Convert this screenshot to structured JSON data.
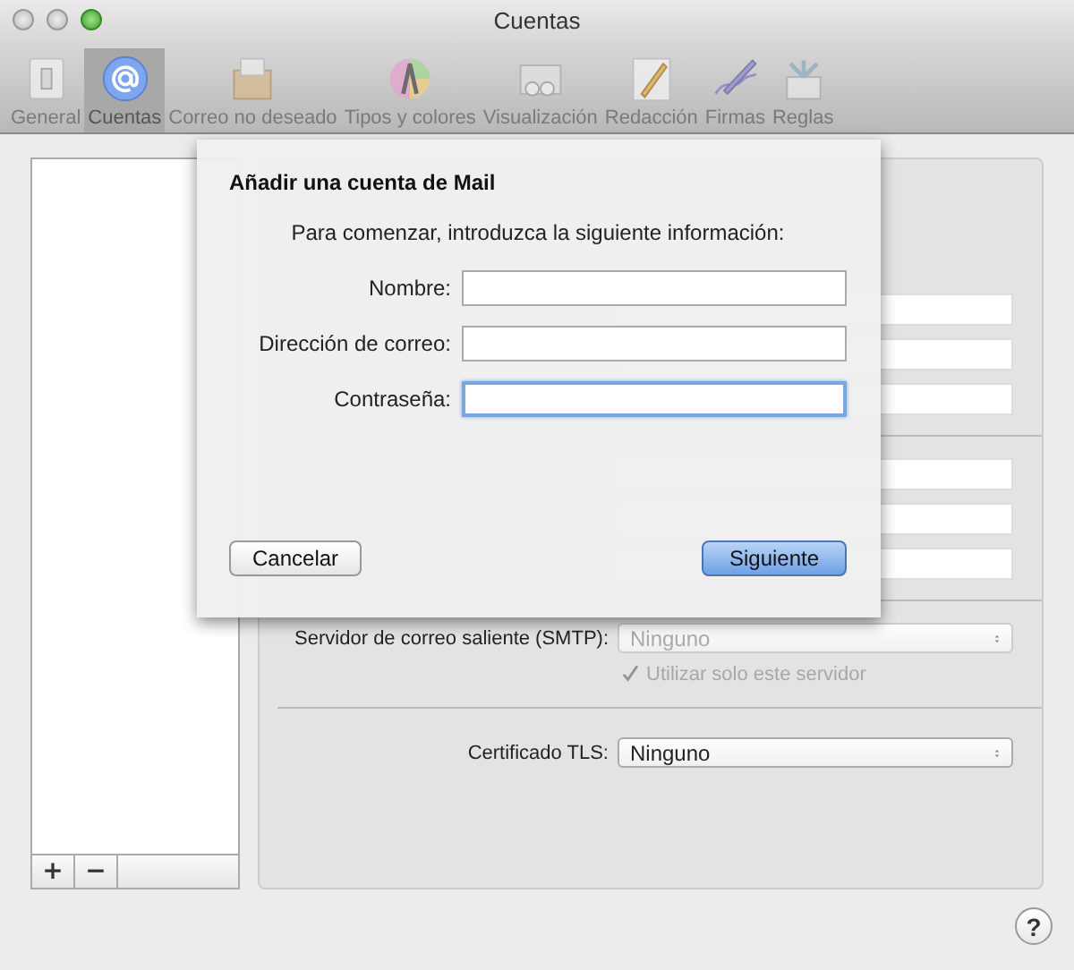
{
  "window": {
    "title": "Cuentas"
  },
  "toolbar": [
    {
      "label": "General",
      "selected": false
    },
    {
      "label": "Cuentas",
      "selected": true
    },
    {
      "label": "Correo no deseado",
      "selected": false
    },
    {
      "label": "Tipos y colores",
      "selected": false
    },
    {
      "label": "Visualización",
      "selected": false
    },
    {
      "label": "Redacción",
      "selected": false
    },
    {
      "label": "Firmas",
      "selected": false
    },
    {
      "label": "Reglas",
      "selected": false
    }
  ],
  "account_list": {
    "buttons": [
      "+",
      "−"
    ]
  },
  "settings": {
    "smtp": {
      "label": "Servidor de correo saliente (SMTP):",
      "value": "Ninguno",
      "disabled": true
    },
    "only_this_server": {
      "label": "Utilizar solo este servidor",
      "checked": true,
      "disabled": true
    },
    "tls": {
      "label": "Certificado TLS:",
      "value": "Ninguno",
      "disabled": false
    }
  },
  "sheet": {
    "title": "Añadir una cuenta de Mail",
    "subtitle": "Para comenzar, introduzca la siguiente información:",
    "fields": [
      {
        "label": "Nombre:",
        "focused": false
      },
      {
        "label": "Dirección de correo:",
        "focused": false
      },
      {
        "label": "Contraseña:",
        "focused": true
      }
    ],
    "buttons": [
      {
        "label": "Cancelar",
        "default": false
      },
      {
        "label": "Siguiente",
        "default": true
      }
    ]
  },
  "help": "?"
}
